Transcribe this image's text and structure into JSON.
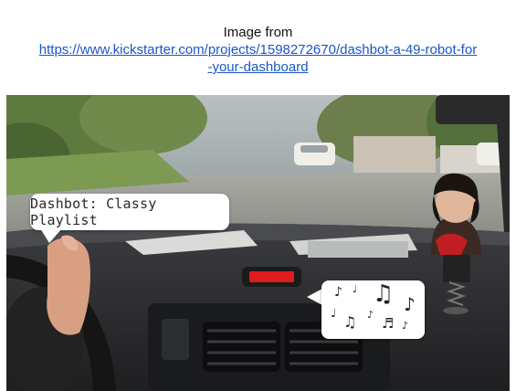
{
  "caption": {
    "prefix": "Image from",
    "link": "https://www.kickstarter.com/projects/1598272670/dashbot-a-49-robot-for-your-dashboard"
  },
  "photo": {
    "speech_bubble": "Dashbot: Classy Playlist",
    "music_icon": "music-notes-icon"
  },
  "colors": {
    "link": "#1a56c8",
    "dashboard": "#2b2c2e",
    "sky": "#9fa9ad",
    "display_red": "#e01b1b"
  }
}
